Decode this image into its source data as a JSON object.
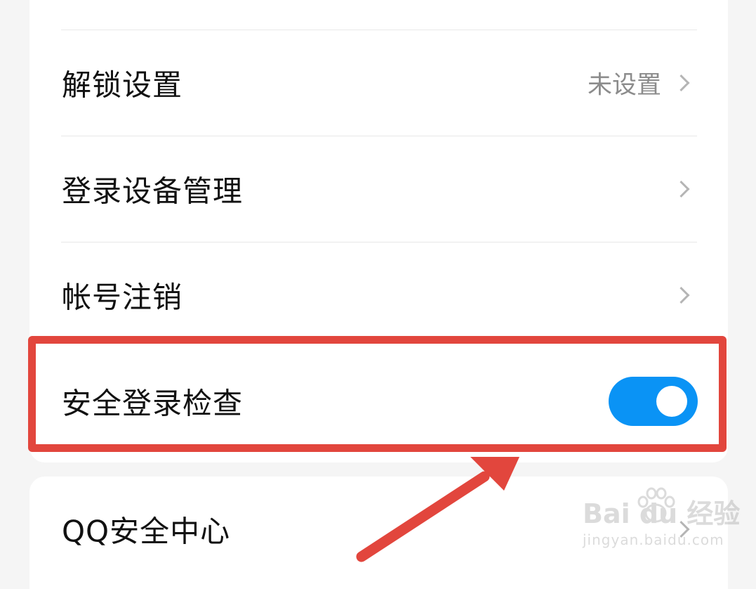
{
  "settings": {
    "rows": [
      {
        "label": "解锁设置",
        "value": "未设置"
      },
      {
        "label": "登录设备管理"
      },
      {
        "label": "帐号注销"
      },
      {
        "label": "安全登录检查",
        "toggle_on": true
      },
      {
        "label": "QQ安全中心"
      }
    ]
  },
  "watermark": {
    "main": "Bai du 经验",
    "sub": "jingyan.baidu.com"
  },
  "colors": {
    "toggle_on": "#0a93f5",
    "highlight": "#e2463d",
    "background": "#f5f5f5",
    "card": "#ffffff"
  },
  "icons": [
    "chevron-right-icon",
    "toggle-switch",
    "annotation-arrow",
    "baidu-paw-icon"
  ]
}
